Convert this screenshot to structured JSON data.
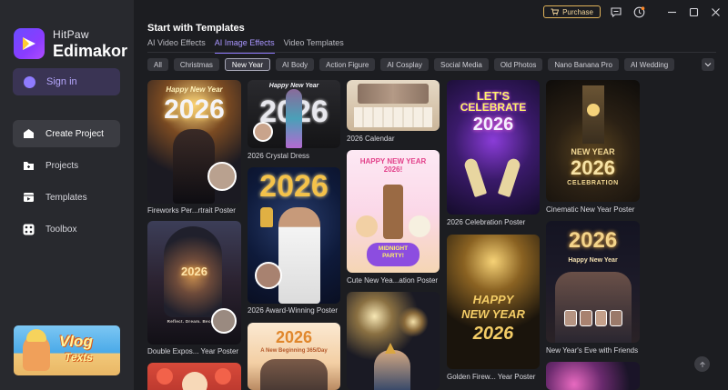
{
  "brand": {
    "line1": "HitPaw",
    "line2": "Edimakor"
  },
  "sidebar": {
    "signin": "Sign in",
    "items": [
      {
        "label": "Create Project",
        "icon": "home-icon"
      },
      {
        "label": "Projects",
        "icon": "folder-icon"
      },
      {
        "label": "Templates",
        "icon": "templates-icon"
      },
      {
        "label": "Toolbox",
        "icon": "toolbox-icon"
      }
    ],
    "promo": {
      "line1": "Vlog",
      "line2": "Texts"
    }
  },
  "topbar": {
    "purchase": "Purchase"
  },
  "main": {
    "title": "Start with Templates",
    "tabs": [
      "AI Video Effects",
      "AI Image Effects",
      "Video Templates"
    ],
    "active_tab": "AI Image Effects",
    "chips": [
      "All",
      "Christmas",
      "New Year",
      "AI Body",
      "Action Figure",
      "AI Cosplay",
      "Social Media",
      "Old Photos",
      "Nano Banana Pro",
      "AI Wedding"
    ],
    "active_chip": "New Year"
  },
  "cards": {
    "c1": {
      "label": "Fireworks Per...rtrait Poster",
      "t1": "Happy New Year",
      "t2": "2026"
    },
    "c2": {
      "label": "Double Expos... Year Poster",
      "t1": "2026",
      "t2": "Reflect. Dream. Become."
    },
    "c3": {
      "label": "2026 Crystal Dress",
      "t1": "Happy New Year",
      "t2": "2026"
    },
    "c4": {
      "label": "2026 Award-Winning Poster",
      "t1": "2026"
    },
    "c5": {
      "t1": "2026",
      "t2": "A New Beginning 365/Day"
    },
    "c6": {
      "label": "2026 Calendar"
    },
    "c7": {
      "label": "Cute New Yea...ation Poster",
      "t1": "HAPPY NEW YEAR 2026!",
      "t2": "MIDNIGHT PARTY!"
    },
    "c9": {
      "label": "2026 Celebration Poster",
      "t1": "LET'S",
      "t2": "CELEBRATE",
      "t3": "2026"
    },
    "c10": {
      "label": "Golden Firew... Year Poster",
      "t1": "HAPPY",
      "t2": "NEW YEAR",
      "t3": "2026"
    },
    "c11": {
      "label": "Cinematic New Year Poster",
      "t1": "NEW YEAR",
      "t2": "2026",
      "t3": "CELEBRATION"
    },
    "c12": {
      "label": "New Year's Eve with Friends",
      "t1": "2026",
      "t2": "Happy New Year"
    }
  }
}
